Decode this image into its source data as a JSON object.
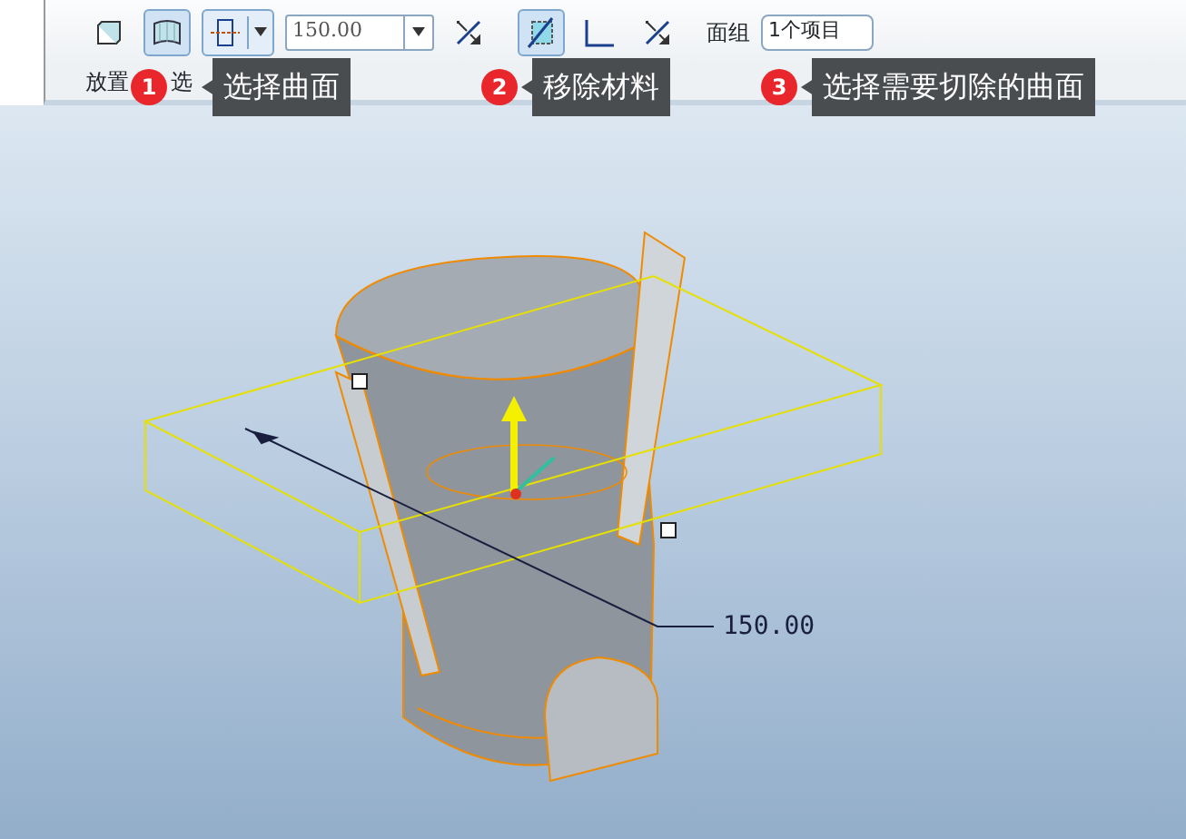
{
  "toolbar": {
    "items": [
      {
        "kind": "solid",
        "selected": false
      },
      {
        "kind": "surface",
        "selected": true
      },
      {
        "kind": "plane",
        "selected": true
      },
      {
        "kind": "depth",
        "value": "150.00"
      },
      {
        "kind": "flip",
        "selected": false
      },
      {
        "kind": "remove",
        "selected": true
      },
      {
        "kind": "thicken",
        "selected": false
      },
      {
        "kind": "flip",
        "selected": false
      },
      {
        "kind": "label",
        "text": "面组"
      },
      {
        "kind": "collector",
        "value": "1个项目"
      }
    ]
  },
  "tabs": [
    {
      "label": "放置"
    },
    {
      "label": "选"
    }
  ],
  "callouts": [
    {
      "number": "1",
      "text": "选择曲面"
    },
    {
      "number": "2",
      "text": "移除材料"
    },
    {
      "number": "3",
      "text": "选择需要切除的曲面"
    }
  ],
  "viewport": {
    "dimension": "150.00"
  }
}
